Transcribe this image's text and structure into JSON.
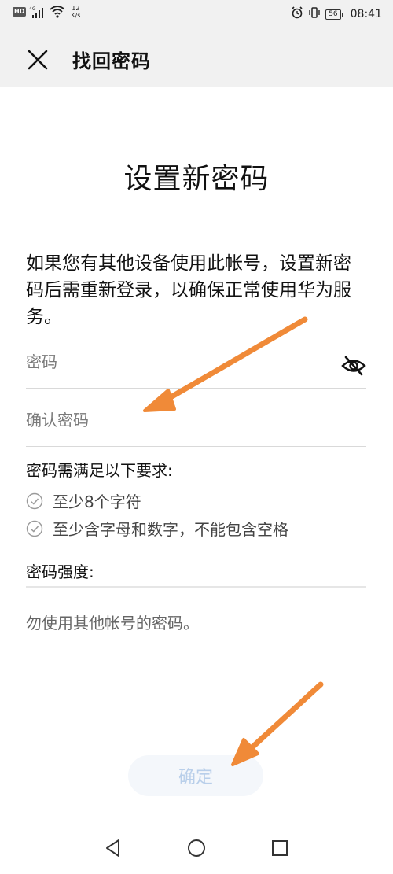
{
  "status_bar": {
    "hd_badge": "HD",
    "network": "4G",
    "speed_value": "12",
    "speed_unit": "K/s",
    "battery": "56",
    "time": "08:41"
  },
  "app_bar": {
    "title": "找回密码",
    "close_icon": "close-icon"
  },
  "page": {
    "title": "设置新密码",
    "description": "如果您有其他设备使用此帐号，设置新密码后需重新登录，以确保正常使用华为服务。"
  },
  "form": {
    "password_placeholder": "密码",
    "confirm_placeholder": "确认密码",
    "eye_icon": "eye-off-icon",
    "requirements_title": "密码需满足以下要求:",
    "requirements": [
      {
        "text": "至少8个字符",
        "icon": "check-circle-icon"
      },
      {
        "text": "至少含字母和数字，不能包含空格",
        "icon": "check-circle-icon"
      }
    ],
    "strength_label": "密码强度:",
    "hint": "勿使用其他帐号的密码。",
    "confirm_button": "确定"
  },
  "colors": {
    "header_bg": "#f1f1f1",
    "arrow": "#f08a38",
    "button_text_disabled": "#b9cfea"
  },
  "nav_bar": {
    "back_icon": "triangle-back-icon",
    "home_icon": "circle-home-icon",
    "recent_icon": "square-recent-icon"
  }
}
